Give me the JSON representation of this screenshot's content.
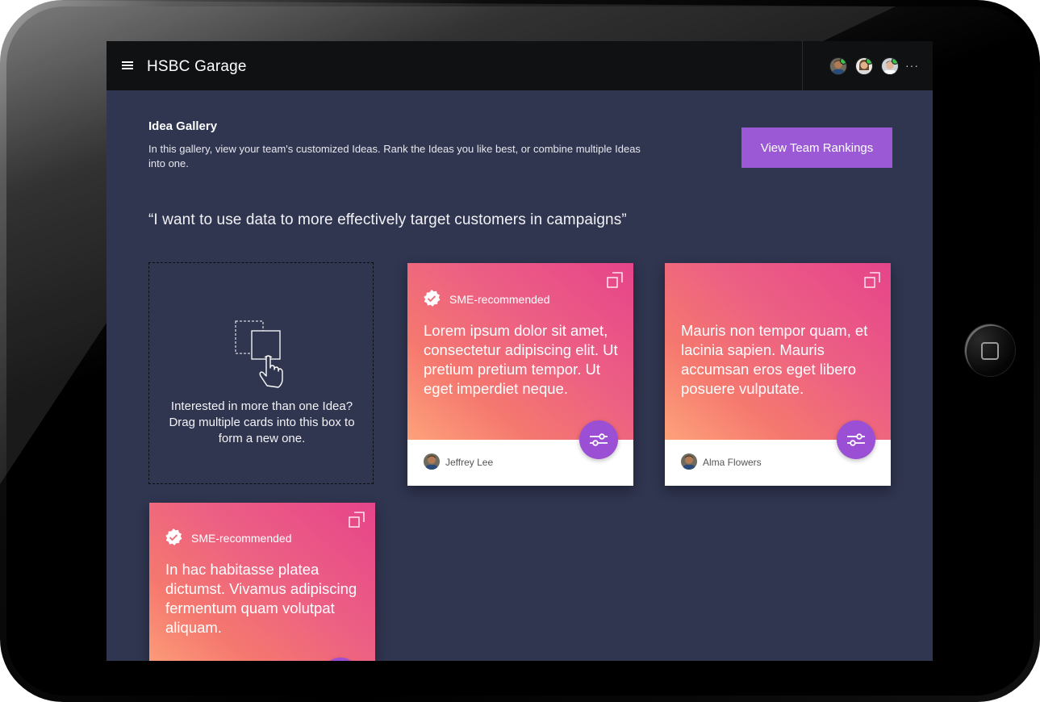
{
  "app": {
    "title": "HSBC Garage"
  },
  "collaborators": [
    {
      "name": "avatar-1",
      "skin": "#b07a55",
      "hair": "#3a2a1e",
      "shirt": "#2b4c7a"
    },
    {
      "name": "avatar-2",
      "skin": "#e2b08e",
      "hair": "#6b4a2e",
      "shirt": "#d9d9d9"
    },
    {
      "name": "avatar-3",
      "skin": "#e0b497",
      "hair": "#4a3a2a",
      "shirt": "#ffffff"
    }
  ],
  "more_label": "···",
  "gallery": {
    "heading": "Idea Gallery",
    "description": "In this gallery, view your team's customized Ideas. Rank the Ideas you like best, or combine multiple Ideas into one.",
    "rank_button": "View Team Rankings"
  },
  "quote": "“I want to use data to more effectively target customers in campaigns”",
  "drop_zone": {
    "text": "Interested in more than one Idea? Drag multiple cards into this box to form a new one."
  },
  "cards": [
    {
      "sme": true,
      "sme_label": "SME-recommended",
      "text": "Lorem ipsum dolor sit amet, consectetur adipiscing elit. Ut pretium pretium tempor. Ut eget imperdiet neque.",
      "author": "Jeffrey Lee"
    },
    {
      "sme": false,
      "sme_label": "",
      "text": "Mauris non tempor quam, et lacinia sapien. Mauris accumsan eros eget libero posuere vulputate.",
      "author": "Alma Flowers"
    },
    {
      "sme": true,
      "sme_label": "SME-recommended",
      "text": "In hac habitasse platea dictumst. Vivamus adipiscing fermentum quam volutpat aliquam.",
      "author": ""
    }
  ],
  "colors": {
    "screen_bg": "#303550",
    "topbar_bg": "#0f1113",
    "accent_purple": "#9b59d6",
    "card_gradient_start": "#fda27a",
    "card_gradient_end": "#e6448a"
  }
}
